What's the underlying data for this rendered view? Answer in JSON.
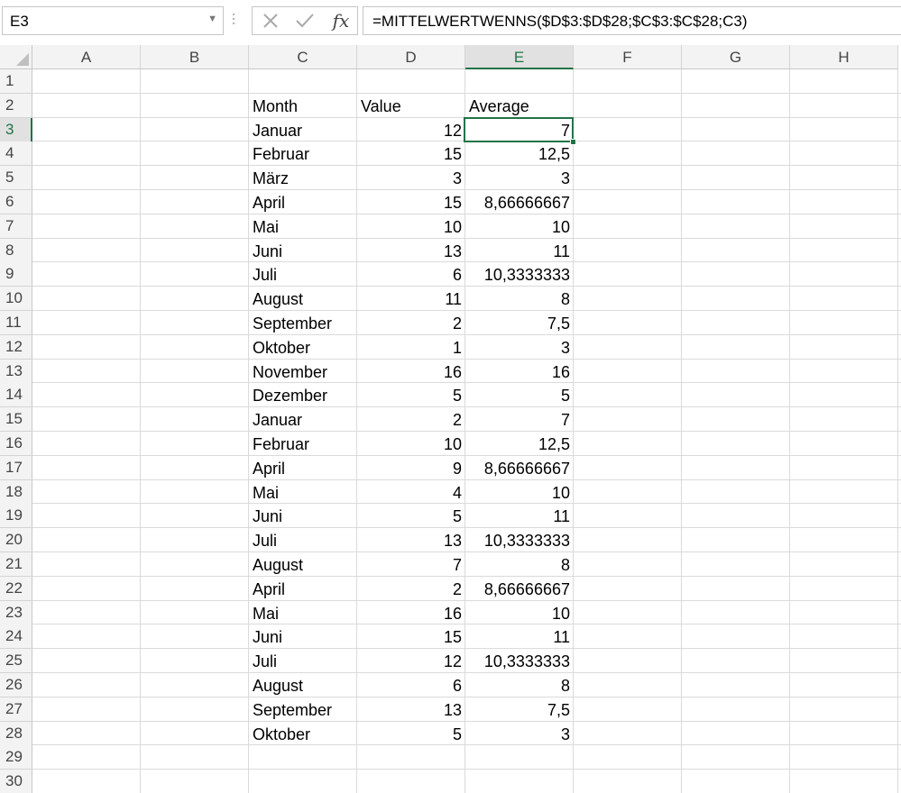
{
  "name_box": {
    "value": "E3"
  },
  "formula_bar": {
    "formula": "=MITTELWERTWENNS($D$3:$D$28;$C$3:$C$28;C3)",
    "fx_label": "fx"
  },
  "icons": {
    "cancel": "x-icon",
    "enter": "check-icon",
    "insert_function": "fx-icon",
    "name_box_dropdown": "chevron-down-icon"
  },
  "colors": {
    "selection": "#217346",
    "header_bg": "#f3f3f3",
    "gridline": "#dadada"
  },
  "selected_cell": "E3",
  "columns": [
    "A",
    "B",
    "C",
    "D",
    "E",
    "F",
    "G",
    "H"
  ],
  "rows": [
    "1",
    "2",
    "3",
    "4",
    "5",
    "6",
    "7",
    "8",
    "9",
    "10",
    "11",
    "12",
    "13",
    "14",
    "15",
    "16",
    "17",
    "18",
    "19",
    "20",
    "21",
    "22",
    "23",
    "24",
    "25",
    "26",
    "27",
    "28",
    "29",
    "30"
  ],
  "table": {
    "headers": {
      "month": "Month",
      "value": "Value",
      "average": "Average"
    },
    "data": [
      {
        "month": "Januar",
        "value": "12",
        "average": "7"
      },
      {
        "month": "Februar",
        "value": "15",
        "average": "12,5"
      },
      {
        "month": "März",
        "value": "3",
        "average": "3"
      },
      {
        "month": "April",
        "value": "15",
        "average": "8,66666667"
      },
      {
        "month": "Mai",
        "value": "10",
        "average": "10"
      },
      {
        "month": "Juni",
        "value": "13",
        "average": "11"
      },
      {
        "month": "Juli",
        "value": "6",
        "average": "10,3333333"
      },
      {
        "month": "August",
        "value": "11",
        "average": "8"
      },
      {
        "month": "September",
        "value": "2",
        "average": "7,5"
      },
      {
        "month": "Oktober",
        "value": "1",
        "average": "3"
      },
      {
        "month": "November",
        "value": "16",
        "average": "16"
      },
      {
        "month": "Dezember",
        "value": "5",
        "average": "5"
      },
      {
        "month": "Januar",
        "value": "2",
        "average": "7"
      },
      {
        "month": "Februar",
        "value": "10",
        "average": "12,5"
      },
      {
        "month": "April",
        "value": "9",
        "average": "8,66666667"
      },
      {
        "month": "Mai",
        "value": "4",
        "average": "10"
      },
      {
        "month": "Juni",
        "value": "5",
        "average": "11"
      },
      {
        "month": "Juli",
        "value": "13",
        "average": "10,3333333"
      },
      {
        "month": "August",
        "value": "7",
        "average": "8"
      },
      {
        "month": "April",
        "value": "2",
        "average": "8,66666667"
      },
      {
        "month": "Mai",
        "value": "16",
        "average": "10"
      },
      {
        "month": "Juni",
        "value": "15",
        "average": "11"
      },
      {
        "month": "Juli",
        "value": "12",
        "average": "10,3333333"
      },
      {
        "month": "August",
        "value": "6",
        "average": "8"
      },
      {
        "month": "September",
        "value": "13",
        "average": "7,5"
      },
      {
        "month": "Oktober",
        "value": "5",
        "average": "3"
      }
    ]
  }
}
